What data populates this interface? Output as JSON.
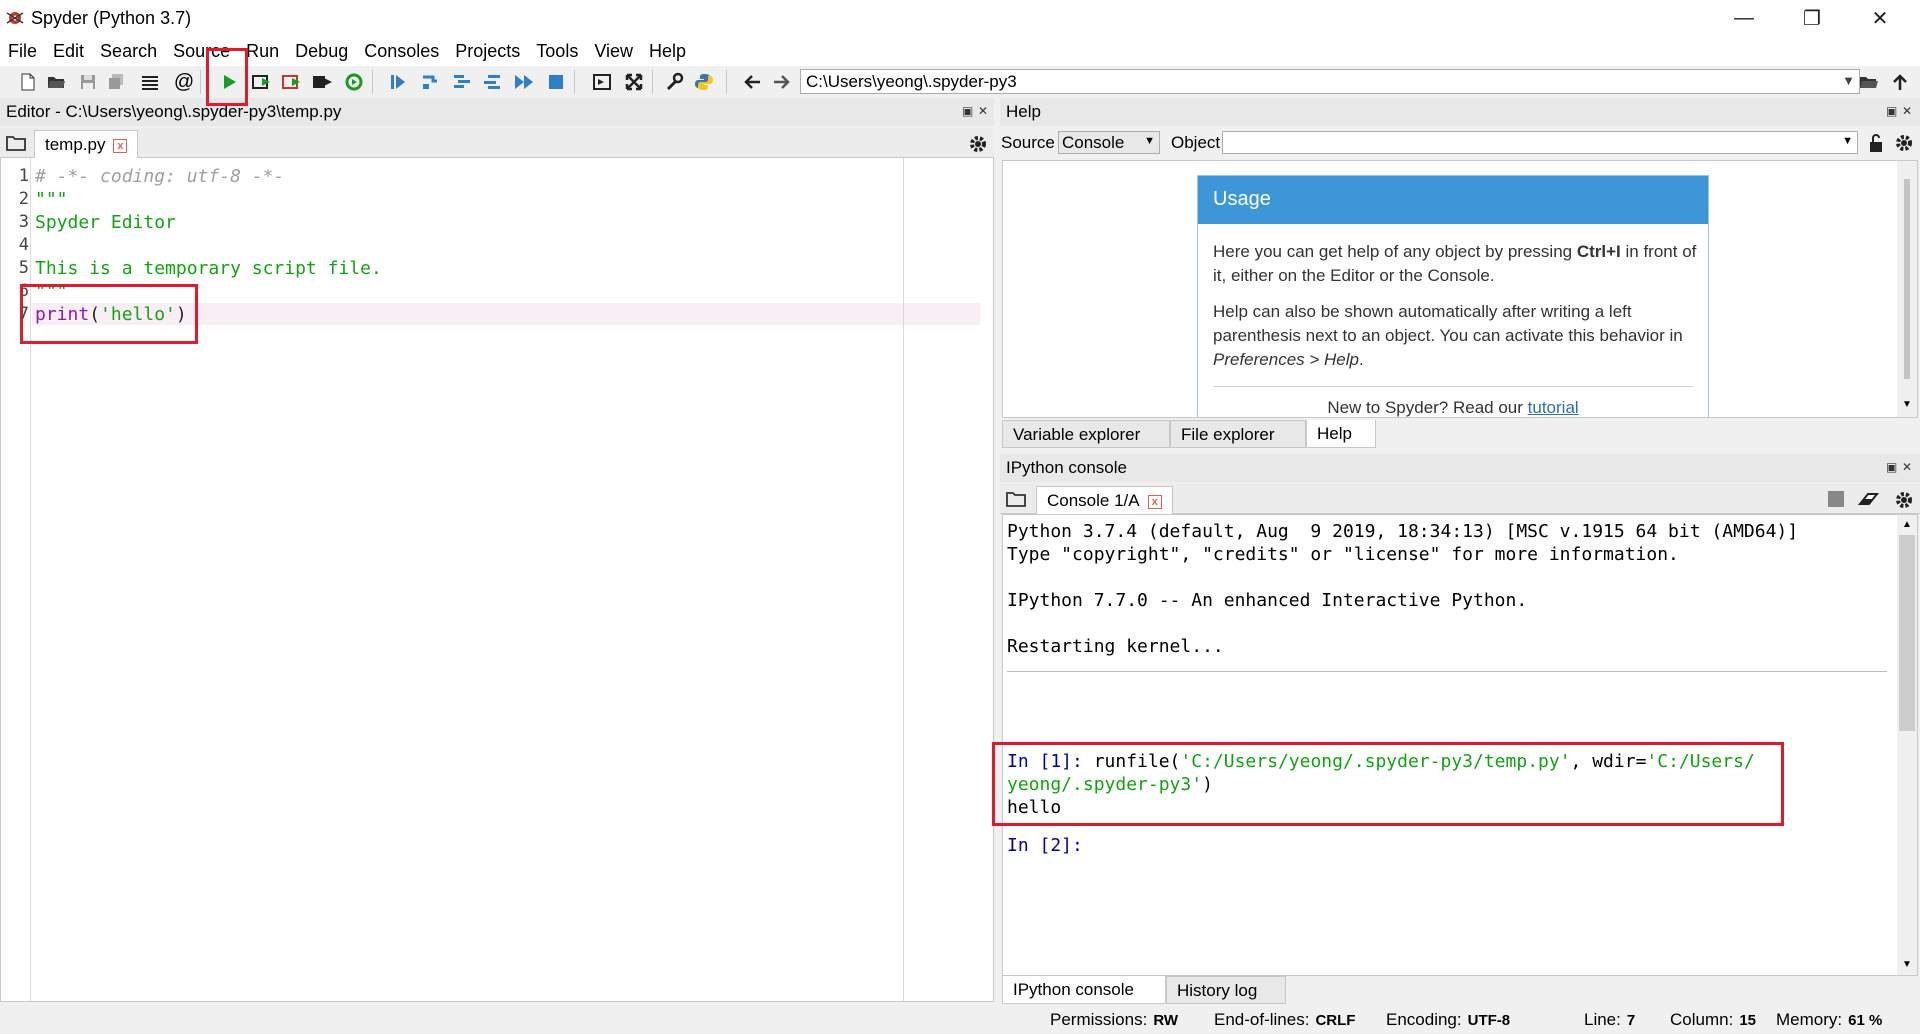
{
  "window": {
    "title": "Spyder (Python 3.7)",
    "minimize": "—",
    "restore": "❐",
    "close": "✕"
  },
  "menu": [
    "File",
    "Edit",
    "Search",
    "Source",
    "Run",
    "Debug",
    "Consoles",
    "Projects",
    "Tools",
    "View",
    "Help"
  ],
  "toolbar": {
    "working_dir": "C:\\Users\\yeong\\.spyder-py3"
  },
  "editor": {
    "header": "Editor - C:\\Users\\yeong\\.spyder-py3\\temp.py",
    "tab": "temp.py",
    "line_numbers": [
      "1",
      "2",
      "3",
      "4",
      "5",
      "6",
      "7"
    ],
    "lines": [
      "# -*- coding: utf-8 -*-",
      "\"\"\"",
      "Spyder Editor",
      "",
      "This is a temporary script file.",
      "\"\"\"",
      "print('hello')"
    ]
  },
  "help": {
    "header": "Help",
    "source_label": "Source",
    "source_value": "Console",
    "object_label": "Object",
    "usage_title": "Usage",
    "para1_a": "Here you can get help of any object by pressing ",
    "para1_key": "Ctrl+I",
    "para1_b": " in front of it, either on the Editor or the Console.",
    "para2_a": "Help can also be shown automatically after writing a left parenthesis next to an object. You can activate this behavior in ",
    "para2_pref": "Preferences > Help",
    "para2_b": ".",
    "footer_a": "New to Spyder? Read our ",
    "footer_link": "tutorial",
    "tabs": [
      "Variable explorer",
      "File explorer",
      "Help"
    ]
  },
  "console": {
    "header": "IPython console",
    "tab": "Console 1/A",
    "lines": [
      "Python 3.7.4 (default, Aug  9 2019, 18:34:13) [MSC v.1915 64 bit (AMD64)]",
      "Type \"copyright\", \"credits\" or \"license\" for more information.",
      "",
      "IPython 7.7.0 -- An enhanced Interactive Python.",
      "",
      "Restarting kernel..."
    ],
    "in1_prompt": "In [1]: ",
    "in1_func": "runfile(",
    "in1_str1": "'C:/Users/yeong/.spyder-py3/temp.py'",
    "in1_mid": ", wdir=",
    "in1_str2a": "'C:/Users/",
    "in1_str2b": "yeong/.spyder-py3'",
    "in1_close": ")",
    "output": "hello",
    "in2_prompt": "In [2]:",
    "tabs": [
      "IPython console",
      "History log"
    ]
  },
  "status": {
    "permissions_label": "Permissions:",
    "permissions": "RW",
    "eol_label": "End-of-lines:",
    "eol": "CRLF",
    "encoding_label": "Encoding:",
    "encoding": "UTF-8",
    "line_label": "Line:",
    "line": "7",
    "column_label": "Column:",
    "column": "15",
    "memory_label": "Memory:",
    "memory": "61 %"
  },
  "colors": {
    "comment": "#a0a0a0",
    "string": "#11a411",
    "keyword": "#8b19b8",
    "prompt": "#0000a8",
    "annotation": "#e01b2e",
    "usage_header": "#3c96d8"
  }
}
